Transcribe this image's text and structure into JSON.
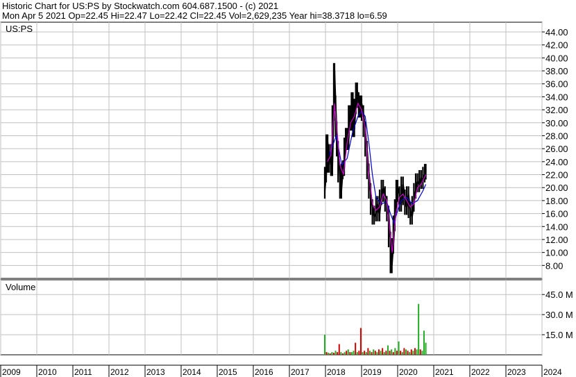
{
  "header": {
    "line1": "Historic Chart for US:PS by Stockwatch.com 604.687.1500 - (c) 2021",
    "line2": "Mon Apr  5 2021  Op=22.45  Hi=22.47  Lo=22.42  Cl=22.45  Vol=2,629,235  Year hi=38.3718  lo=6.59"
  },
  "colors": {
    "price": "#000000",
    "ma_short": "#cc00cc",
    "ma_long": "#0000cc",
    "vol_up": "#22aa22",
    "vol_down": "#cc0000",
    "grid": "#c0c0c0"
  },
  "chart_data": [
    {
      "type": "line",
      "title": "US:PS",
      "ylabel": "",
      "y_ticks": [
        "44.00",
        "42.00",
        "40.00",
        "38.00",
        "36.00",
        "34.00",
        "32.00",
        "30.00",
        "28.00",
        "26.00",
        "24.00",
        "22.00",
        "20.00",
        "18.00",
        "16.00",
        "14.00",
        "12.00",
        "10.00",
        "8.00"
      ],
      "ylim": [
        6,
        45.5
      ],
      "x_ticks": [
        "2009",
        "2010",
        "2011",
        "2012",
        "2013",
        "2014",
        "2015",
        "2016",
        "2017",
        "2018",
        "2019",
        "2020",
        "2021",
        "2022",
        "2023",
        "2024"
      ],
      "xlim": [
        2009.0,
        2024.0
      ],
      "grid": true,
      "series": [
        {
          "values": [
            [
              2017.98,
              19.5
            ],
            [
              2018.02,
              22.0
            ],
            [
              2018.06,
              27.0
            ],
            [
              2018.1,
              23.5
            ],
            [
              2018.15,
              25.5
            ],
            [
              2018.19,
              23.0
            ],
            [
              2018.23,
              31.5
            ],
            [
              2018.25,
              38.0
            ],
            [
              2018.28,
              33.0
            ],
            [
              2018.31,
              29.0
            ],
            [
              2018.35,
              26.0
            ],
            [
              2018.4,
              22.0
            ],
            [
              2018.44,
              19.5
            ],
            [
              2018.48,
              22.5
            ],
            [
              2018.52,
              23.0
            ],
            [
              2018.56,
              26.5
            ],
            [
              2018.6,
              28.0
            ],
            [
              2018.64,
              27.0
            ],
            [
              2018.68,
              31.5
            ],
            [
              2018.72,
              30.0
            ],
            [
              2018.76,
              33.5
            ],
            [
              2018.8,
              29.0
            ],
            [
              2018.84,
              32.5
            ],
            [
              2018.88,
              35.0
            ],
            [
              2018.92,
              33.5
            ],
            [
              2018.96,
              32.0
            ],
            [
              2019.0,
              33.0
            ],
            [
              2019.05,
              31.5
            ],
            [
              2019.1,
              29.0
            ],
            [
              2019.15,
              26.0
            ],
            [
              2019.2,
              22.5
            ],
            [
              2019.25,
              19.5
            ],
            [
              2019.3,
              17.0
            ],
            [
              2019.35,
              15.5
            ],
            [
              2019.4,
              16.0
            ],
            [
              2019.45,
              17.5
            ],
            [
              2019.5,
              16.0
            ],
            [
              2019.55,
              18.5
            ],
            [
              2019.6,
              20.0
            ],
            [
              2019.65,
              19.0
            ],
            [
              2019.7,
              17.5
            ],
            [
              2019.75,
              16.0
            ],
            [
              2019.8,
              12.0
            ],
            [
              2019.84,
              8.0
            ],
            [
              2019.88,
              11.0
            ],
            [
              2019.92,
              14.5
            ],
            [
              2019.96,
              17.0
            ],
            [
              2020.0,
              20.0
            ],
            [
              2020.05,
              19.0
            ],
            [
              2020.1,
              17.5
            ],
            [
              2020.15,
              20.5
            ],
            [
              2020.2,
              18.5
            ],
            [
              2020.25,
              17.0
            ],
            [
              2020.3,
              19.0
            ],
            [
              2020.35,
              16.5
            ],
            [
              2020.4,
              15.5
            ],
            [
              2020.45,
              17.5
            ],
            [
              2020.5,
              19.5
            ],
            [
              2020.55,
              21.0
            ],
            [
              2020.6,
              20.5
            ],
            [
              2020.65,
              21.5
            ],
            [
              2020.7,
              21.0
            ],
            [
              2020.75,
              22.0
            ],
            [
              2020.78,
              22.45
            ]
          ]
        },
        {
          "name": "",
          "values": [
            [
              2018.05,
              24.0
            ],
            [
              2018.15,
              25.0
            ],
            [
              2018.25,
              33.0
            ],
            [
              2018.3,
              30.0
            ],
            [
              2018.4,
              23.5
            ],
            [
              2018.5,
              22.0
            ],
            [
              2018.6,
              27.0
            ],
            [
              2018.7,
              30.0
            ],
            [
              2018.8,
              31.0
            ],
            [
              2018.9,
              33.0
            ],
            [
              2019.0,
              32.0
            ],
            [
              2019.1,
              29.0
            ],
            [
              2019.2,
              22.0
            ],
            [
              2019.3,
              17.5
            ],
            [
              2019.4,
              16.5
            ],
            [
              2019.5,
              17.0
            ],
            [
              2019.6,
              19.0
            ],
            [
              2019.7,
              18.0
            ],
            [
              2019.8,
              12.5
            ],
            [
              2019.85,
              10.0
            ],
            [
              2019.95,
              16.0
            ],
            [
              2020.05,
              18.5
            ],
            [
              2020.15,
              19.0
            ],
            [
              2020.25,
              18.0
            ],
            [
              2020.35,
              17.0
            ],
            [
              2020.45,
              17.5
            ],
            [
              2020.55,
              20.0
            ],
            [
              2020.65,
              20.5
            ],
            [
              2020.78,
              22.0
            ]
          ]
        },
        {
          "name": "",
          "values": [
            [
              2018.1,
              25.0
            ],
            [
              2018.3,
              28.0
            ],
            [
              2018.45,
              23.5
            ],
            [
              2018.6,
              24.5
            ],
            [
              2018.75,
              28.5
            ],
            [
              2018.9,
              31.0
            ],
            [
              2019.0,
              31.8
            ],
            [
              2019.1,
              31.0
            ],
            [
              2019.2,
              27.0
            ],
            [
              2019.3,
              22.0
            ],
            [
              2019.4,
              18.5
            ],
            [
              2019.55,
              17.5
            ],
            [
              2019.7,
              17.8
            ],
            [
              2019.8,
              16.0
            ],
            [
              2019.9,
              14.5
            ],
            [
              2020.0,
              16.5
            ],
            [
              2020.1,
              18.0
            ],
            [
              2020.25,
              18.5
            ],
            [
              2020.4,
              17.5
            ],
            [
              2020.55,
              18.0
            ],
            [
              2020.7,
              19.5
            ],
            [
              2020.78,
              20.5
            ]
          ]
        }
      ]
    },
    {
      "type": "bar",
      "title": "Volume",
      "ylabel": "",
      "y_ticks": [
        "45.0 M",
        "30.0 M",
        "15.0 M"
      ],
      "ylim": [
        0,
        56
      ],
      "x": [
        2017.98,
        2018.03,
        2018.08,
        2018.13,
        2018.18,
        2018.23,
        2018.28,
        2018.33,
        2018.38,
        2018.43,
        2018.48,
        2018.53,
        2018.58,
        2018.63,
        2018.68,
        2018.73,
        2018.78,
        2018.83,
        2018.88,
        2018.93,
        2018.98,
        2019.03,
        2019.08,
        2019.13,
        2019.18,
        2019.23,
        2019.28,
        2019.33,
        2019.38,
        2019.43,
        2019.48,
        2019.53,
        2019.58,
        2019.63,
        2019.68,
        2019.73,
        2019.78,
        2019.83,
        2019.88,
        2019.93,
        2019.98,
        2020.03,
        2020.08,
        2020.13,
        2020.18,
        2020.23,
        2020.28,
        2020.33,
        2020.38,
        2020.43,
        2020.48,
        2020.53,
        2020.58,
        2020.63,
        2020.68,
        2020.73,
        2020.78
      ],
      "values": [
        15,
        2,
        1.5,
        1,
        2,
        1.5,
        3,
        2,
        8,
        2,
        1,
        2,
        3,
        4,
        2,
        2,
        3,
        9,
        2,
        3,
        20,
        2,
        3,
        2,
        5,
        3,
        2,
        4,
        3,
        2,
        4,
        3,
        5,
        2,
        3,
        7,
        3,
        4,
        2,
        5,
        3,
        10,
        3,
        2,
        5,
        4,
        3,
        2,
        4,
        3,
        5,
        4,
        38,
        4,
        3,
        18,
        9
      ],
      "up": [
        true,
        false,
        true,
        false,
        true,
        false,
        true,
        false,
        false,
        true,
        false,
        true,
        false,
        true,
        false,
        true,
        true,
        false,
        true,
        false,
        false,
        true,
        false,
        true,
        false,
        true,
        false,
        true,
        false,
        true,
        false,
        true,
        false,
        true,
        false,
        true,
        false,
        true,
        false,
        true,
        false,
        true,
        false,
        true,
        false,
        true,
        false,
        true,
        false,
        true,
        false,
        true,
        true,
        false,
        true,
        true,
        true
      ]
    }
  ]
}
